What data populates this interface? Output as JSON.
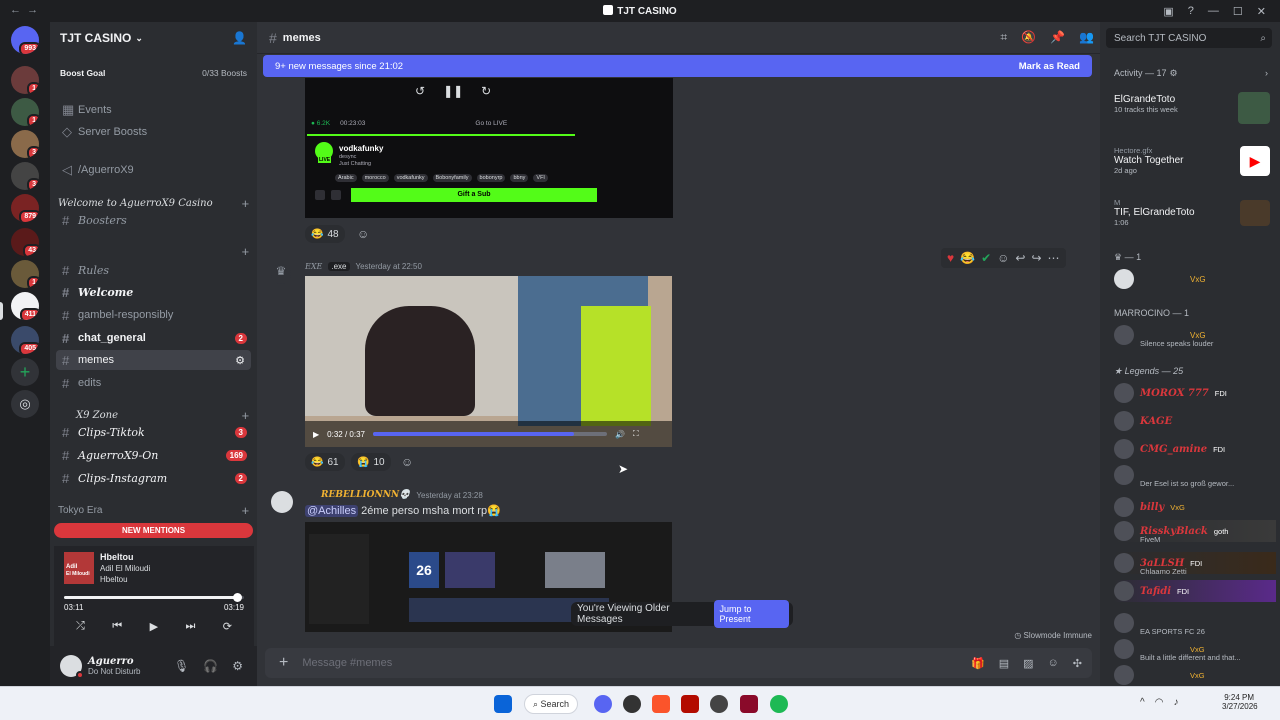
{
  "window": {
    "title": "TJT CASINO"
  },
  "rail": {
    "badges": [
      "993",
      "1",
      "1",
      "3",
      "3",
      "879",
      "43",
      "1",
      "411",
      "405"
    ]
  },
  "sidebar": {
    "guild_name": "TJT CASINO",
    "boost_goal_label": "Boost Goal",
    "boost_goal_value": "0/33 Boosts",
    "top_items": [
      "Events",
      "Server Boosts"
    ],
    "channels_top": [
      {
        "name": "/AguerroX9"
      }
    ],
    "category_welcome": "Welcome to AguerroX9 Casino",
    "boosters": "Boosters",
    "channels_group2": [
      {
        "name": "Rules",
        "style": "italic"
      },
      {
        "name": "Welcome",
        "style": "italic-bold"
      },
      {
        "name": "gambel-responsibly",
        "style": "normal"
      },
      {
        "name": "chat_general",
        "style": "unread",
        "count": "2"
      },
      {
        "name": "memes",
        "style": "active"
      },
      {
        "name": "edits",
        "style": "normal"
      }
    ],
    "category_x9": "X9 Zone",
    "channels_x9": [
      {
        "name": "Clips-Tiktok",
        "count": "3"
      },
      {
        "name": "AguerroX9-On",
        "count": "169"
      },
      {
        "name": "Clips-Instagram",
        "count": "2"
      }
    ],
    "category_tokyo": "Tokyo Era",
    "new_mentions": "NEW MENTIONS"
  },
  "player": {
    "track": "Hbeltou",
    "artist": "Adil El Miloudi",
    "album": "Hbeltou",
    "art_line1": "Adil",
    "art_line2": "El Miloudi",
    "elapsed": "03:11",
    "duration": "03:19",
    "progress": 0.96
  },
  "user": {
    "name": "Aguerro",
    "status": "Do Not Disturb"
  },
  "header": {
    "channel": "memes",
    "search_placeholder": "Search TJT CASINO"
  },
  "banner": {
    "text": "9+ new messages since 21:02",
    "action": "Mark as Read"
  },
  "embed_top": {
    "stream_name": "vodkafunky",
    "stream_sub1": "desync",
    "stream_sub2": "Just Chatting",
    "tags": [
      "Arabic",
      "morocco",
      "vodkafunky",
      "Bobonyfamily",
      "bobonyrp",
      "bbny",
      "VFl"
    ],
    "viewers": "6.2K",
    "uptime": "00:23:03",
    "live": "LIVE",
    "gift": "Gift a Sub",
    "go_live": "Go to LIVE"
  },
  "reactions_1": [
    {
      "emoji": "😂",
      "count": "48"
    }
  ],
  "message_2": {
    "author": "EXE",
    "tag": ".exe",
    "timestamp": "Yesterday at 22:50",
    "video_time": "0:32 / 0:37",
    "video_progress": 0.86,
    "reactions": [
      {
        "emoji": "😂",
        "count": "61"
      },
      {
        "emoji": "😭",
        "count": "10"
      }
    ]
  },
  "message_3": {
    "author": "REBELLIONNN💀",
    "timestamp": "Yesterday at 23:28",
    "mention": "@Achilles",
    "text": "2éme perso msha mort rp😭",
    "thumb_number": "26"
  },
  "older": {
    "text": "You're Viewing Older Messages",
    "action": "Jump to Present"
  },
  "slowmode": "Slowmode Immune",
  "composer": {
    "placeholder": "Message #memes"
  },
  "activity": {
    "header": "Activity — 17",
    "items": [
      {
        "user": "ElGrandeToto",
        "line2": "10 tracks this week"
      },
      {
        "user": "Hectore.gfx",
        "title": "Watch Together",
        "line2": "2d ago"
      },
      {
        "user": "M",
        "title": "TIF, ElGrandeToto",
        "line2": "1:06"
      }
    ]
  },
  "members": {
    "group1": "— 1",
    "group1_member_tag": "VxG",
    "group2": "MARROCINO — 1",
    "group2_member_tag": "VxG",
    "group2_status": "Silence speaks louder",
    "group3": "Legends — 25",
    "list": [
      {
        "name": "MOROX 777",
        "tag": "FDI",
        "sub": ""
      },
      {
        "name": "KAGE",
        "tag": "",
        "sub": ""
      },
      {
        "name": "CMG_amine",
        "tag": "FDI",
        "sub": ""
      },
      {
        "name": "",
        "tag": "",
        "sub": "Der Esel ist so groß gewor..."
      },
      {
        "name": "billy",
        "tag": "VxG",
        "sub": ""
      },
      {
        "name": "RisskyBlack",
        "tag": "goth",
        "sub": "FiveM"
      },
      {
        "name": "3aLLSH",
        "tag": "FDI",
        "sub": "Chlaamo Zetti"
      },
      {
        "name": "Tafidi",
        "tag": "FDI",
        "sub": ""
      },
      {
        "name": "",
        "tag": "",
        "sub": "EA SPORTS FC 26"
      },
      {
        "name": "",
        "tag": "VxG",
        "sub": "Built a little different and that..."
      },
      {
        "name": "",
        "tag": "VxG",
        "sub": ""
      }
    ]
  },
  "taskbar": {
    "search": "Search",
    "time": "9:24 PM",
    "date": "3/27/2026"
  },
  "colors": {
    "blurple": "#5865f2",
    "red": "#da373c",
    "green": "#23a55a",
    "bg": "#313338"
  }
}
